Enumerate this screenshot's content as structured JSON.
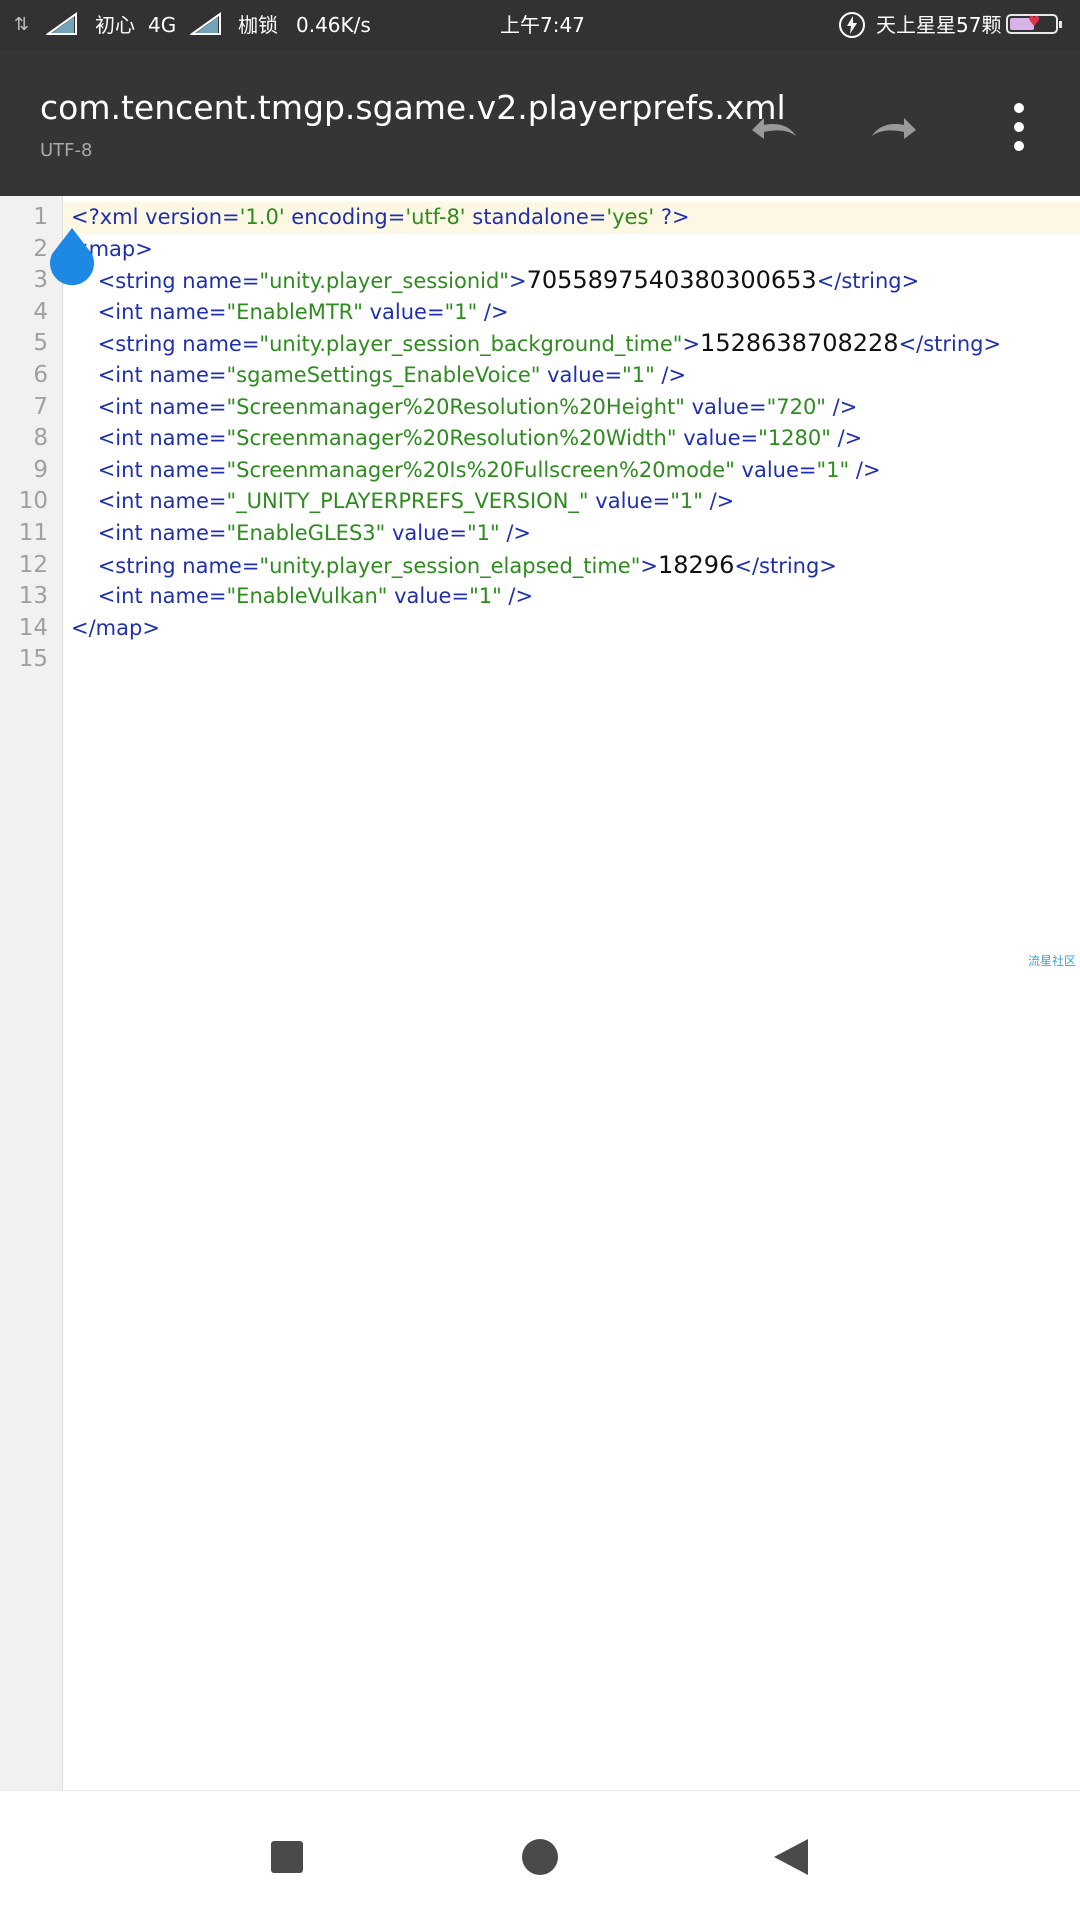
{
  "status_bar": {
    "carrier1": "初心",
    "network": "4G",
    "carrier2": "枷锁",
    "speed": "0.46K/s",
    "time": "上午7:47",
    "right_text": "天上星星57颗",
    "battery_level": 0.55
  },
  "app_bar": {
    "title": "com.tencent.tmgp.sgame.v2.playerprefs.xml",
    "encoding": "UTF-8"
  },
  "editor": {
    "current_line": 1,
    "lines": [
      {
        "number": "1",
        "segments": [
          [
            "tag",
            "<?xml "
          ],
          [
            "att",
            "version="
          ],
          [
            "val",
            "'1.0'"
          ],
          [
            "att",
            " encoding="
          ],
          [
            "val",
            "'utf-8'"
          ],
          [
            "att",
            " standalone="
          ],
          [
            "val",
            "'yes'"
          ],
          [
            "tag",
            " ?>"
          ]
        ]
      },
      {
        "number": "2",
        "segments": [
          [
            "tag",
            "<map>"
          ]
        ]
      },
      {
        "number": "3",
        "segments": [
          [
            "tag",
            "    <string "
          ],
          [
            "att",
            "name="
          ],
          [
            "val",
            "\"unity.player_sessionid\""
          ],
          [
            "tag",
            ">"
          ],
          [
            "txt",
            "7055897540380300653"
          ],
          [
            "tag",
            "</string>"
          ]
        ]
      },
      {
        "number": "4",
        "segments": [
          [
            "tag",
            "    <int "
          ],
          [
            "att",
            "name="
          ],
          [
            "val",
            "\"EnableMTR\""
          ],
          [
            "att",
            " value="
          ],
          [
            "val",
            "\"1\""
          ],
          [
            "tag",
            " />"
          ]
        ]
      },
      {
        "number": "5",
        "segments": [
          [
            "tag",
            "    <string "
          ],
          [
            "att",
            "name="
          ],
          [
            "val",
            "\"unity.player_session_background_time\""
          ],
          [
            "tag",
            ">"
          ],
          [
            "txt",
            "1528638708228"
          ],
          [
            "tag",
            "</string>"
          ]
        ]
      },
      {
        "number": "6",
        "segments": [
          [
            "tag",
            "    <int "
          ],
          [
            "att",
            "name="
          ],
          [
            "val",
            "\"sgameSettings_EnableVoice\""
          ],
          [
            "att",
            " value="
          ],
          [
            "val",
            "\"1\""
          ],
          [
            "tag",
            " />"
          ]
        ]
      },
      {
        "number": "7",
        "segments": [
          [
            "tag",
            "    <int "
          ],
          [
            "att",
            "name="
          ],
          [
            "val",
            "\"Screenmanager%20Resolution%20Height\""
          ],
          [
            "att",
            " value="
          ],
          [
            "val",
            "\"720\""
          ],
          [
            "tag",
            " />"
          ]
        ]
      },
      {
        "number": "8",
        "segments": [
          [
            "tag",
            "    <int "
          ],
          [
            "att",
            "name="
          ],
          [
            "val",
            "\"Screenmanager%20Resolution%20Width\""
          ],
          [
            "att",
            " value="
          ],
          [
            "val",
            "\"1280\""
          ],
          [
            "tag",
            " />"
          ]
        ]
      },
      {
        "number": "9",
        "segments": [
          [
            "tag",
            "    <int "
          ],
          [
            "att",
            "name="
          ],
          [
            "val",
            "\"Screenmanager%20Is%20Fullscreen%20mode\""
          ],
          [
            "att",
            " value="
          ],
          [
            "val",
            "\"1\""
          ],
          [
            "tag",
            " />"
          ]
        ]
      },
      {
        "number": "10",
        "segments": [
          [
            "tag",
            "    <int "
          ],
          [
            "att",
            "name="
          ],
          [
            "val",
            "\"_UNITY_PLAYERPREFS_VERSION_\""
          ],
          [
            "att",
            " value="
          ],
          [
            "val",
            "\"1\""
          ],
          [
            "tag",
            " />"
          ]
        ]
      },
      {
        "number": "11",
        "segments": [
          [
            "tag",
            "    <int "
          ],
          [
            "att",
            "name="
          ],
          [
            "val",
            "\"EnableGLES3\""
          ],
          [
            "att",
            " value="
          ],
          [
            "val",
            "\"1\""
          ],
          [
            "tag",
            " />"
          ]
        ]
      },
      {
        "number": "12",
        "segments": [
          [
            "tag",
            "    <string "
          ],
          [
            "att",
            "name="
          ],
          [
            "val",
            "\"unity.player_session_elapsed_time\""
          ],
          [
            "tag",
            ">"
          ],
          [
            "txt",
            "18296"
          ],
          [
            "tag",
            "</string>"
          ]
        ]
      },
      {
        "number": "13",
        "segments": [
          [
            "tag",
            "    <int "
          ],
          [
            "att",
            "name="
          ],
          [
            "val",
            "\"EnableVulkan\""
          ],
          [
            "att",
            " value="
          ],
          [
            "val",
            "\"1\""
          ],
          [
            "tag",
            " />"
          ]
        ]
      },
      {
        "number": "14",
        "segments": [
          [
            "tag",
            "</map>"
          ]
        ]
      },
      {
        "number": "15",
        "segments": []
      }
    ]
  },
  "watermark": "流星社区",
  "colors": {
    "tag": "#1f2fb0",
    "value": "#2e8b1e",
    "text": "#111111",
    "current_line_bg": "#fcf8e3",
    "handle": "#1e88e5"
  },
  "icons": {
    "undo": "undo-icon",
    "redo": "redo-icon",
    "menu": "more-vert-icon",
    "recent": "square-icon",
    "home": "circle-icon",
    "back": "triangle-back-icon"
  }
}
